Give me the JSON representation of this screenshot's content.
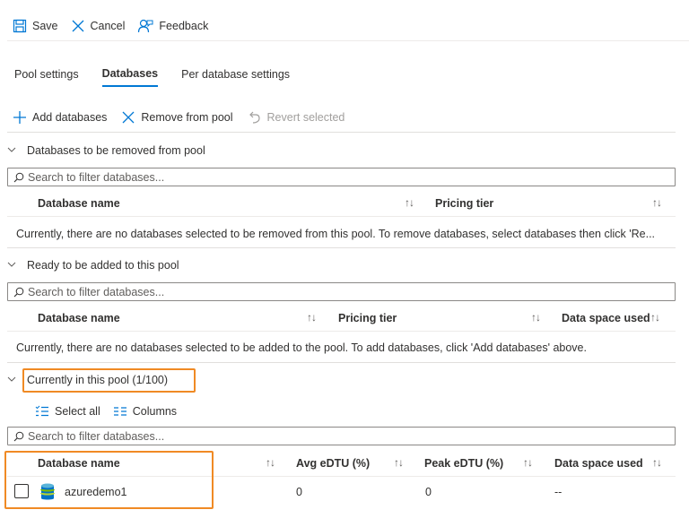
{
  "toolbar": {
    "save": "Save",
    "cancel": "Cancel",
    "feedback": "Feedback"
  },
  "tabs": [
    {
      "label": "Pool settings",
      "active": false
    },
    {
      "label": "Databases",
      "active": true
    },
    {
      "label": "Per database settings",
      "active": false
    }
  ],
  "commands": {
    "add": "Add databases",
    "remove": "Remove from pool",
    "revert": "Revert selected"
  },
  "search_placeholder": "Search to filter databases...",
  "removed_section": {
    "title": "Databases to be removed from pool",
    "columns": [
      "Database name",
      "Pricing tier"
    ],
    "empty": "Currently, there are no databases selected to be removed from this pool. To remove databases, select databases then click 'Re..."
  },
  "added_section": {
    "title": "Ready to be added to this pool",
    "columns": [
      "Database name",
      "Pricing tier",
      "Data space used"
    ],
    "empty": "Currently, there are no databases selected to be added to the pool. To add databases, click 'Add databases' above."
  },
  "current_section": {
    "title": "Currently in this pool (1/100)",
    "select_all": "Select all",
    "columns_btn": "Columns",
    "columns": [
      "Database name",
      "Avg eDTU (%)",
      "Peak eDTU (%)",
      "Data space used"
    ],
    "rows": [
      {
        "name": "azuredemo1",
        "avg": "0",
        "peak": "0",
        "space": "--"
      }
    ]
  },
  "colors": {
    "accent": "#0078d4",
    "highlight": "#f08a24"
  }
}
